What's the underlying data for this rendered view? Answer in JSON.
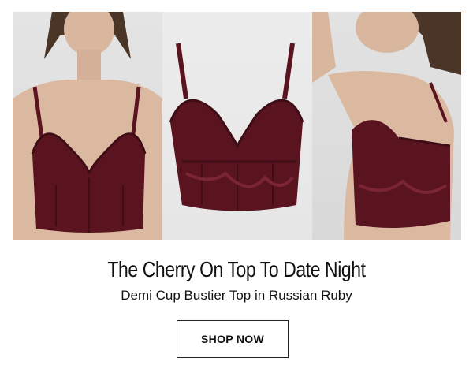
{
  "gallery": {
    "images": [
      {
        "name": "model-front-image"
      },
      {
        "name": "product-flat-image"
      },
      {
        "name": "model-back-image"
      }
    ],
    "colors": {
      "product": "#5a1420",
      "product_dark": "#3f0d16",
      "skin": "#d9b79f",
      "hair": "#4a3527"
    }
  },
  "headline": "The Cherry On Top To Date Night",
  "subline": "Demi Cup Bustier Top in Russian Ruby",
  "cta": {
    "label": "SHOP NOW"
  }
}
